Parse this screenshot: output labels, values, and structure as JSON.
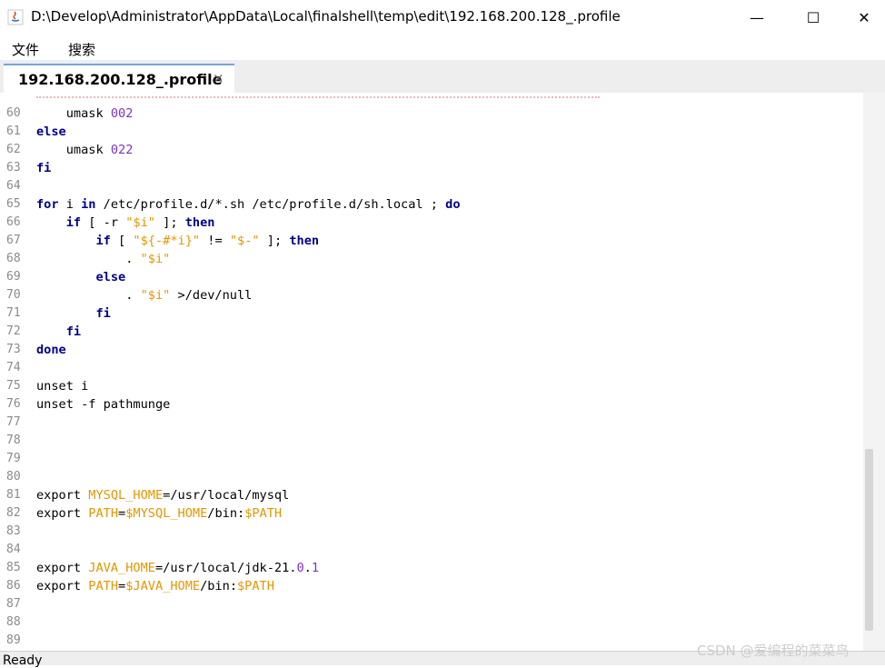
{
  "window": {
    "title": "D:\\Develop\\Administrator\\AppData\\Local\\finalshell\\temp\\edit\\192.168.200.128_.profile",
    "minimize": "—",
    "maximize": "☐",
    "close": "✕"
  },
  "menu": [
    "文件",
    "搜索"
  ],
  "tab": {
    "label": "192.168.200.128_.profile",
    "close": "×"
  },
  "editor": {
    "lines": [
      {
        "n": "60",
        "code": [
          {
            "t": "    umask "
          },
          {
            "t": "002",
            "c": "num"
          }
        ]
      },
      {
        "n": "61",
        "code": [
          {
            "t": "else",
            "c": "kw"
          }
        ]
      },
      {
        "n": "62",
        "code": [
          {
            "t": "    umask "
          },
          {
            "t": "022",
            "c": "num"
          }
        ]
      },
      {
        "n": "63",
        "code": [
          {
            "t": "fi",
            "c": "kw"
          }
        ]
      },
      {
        "n": "64",
        "code": []
      },
      {
        "n": "65",
        "code": [
          {
            "t": "for",
            "c": "kw"
          },
          {
            "t": " i "
          },
          {
            "t": "in",
            "c": "kw"
          },
          {
            "t": " /etc/profile.d/*.sh /etc/profile.d/sh.local ; "
          },
          {
            "t": "do",
            "c": "kw"
          }
        ]
      },
      {
        "n": "66",
        "code": [
          {
            "t": "    "
          },
          {
            "t": "if",
            "c": "kw"
          },
          {
            "t": " [ -r "
          },
          {
            "t": "\"$i\"",
            "c": "str"
          },
          {
            "t": " ]; "
          },
          {
            "t": "then",
            "c": "kw"
          }
        ]
      },
      {
        "n": "67",
        "code": [
          {
            "t": "        "
          },
          {
            "t": "if",
            "c": "kw"
          },
          {
            "t": " [ "
          },
          {
            "t": "\"${-#*i}\"",
            "c": "str"
          },
          {
            "t": " != "
          },
          {
            "t": "\"$-\"",
            "c": "str"
          },
          {
            "t": " ]; "
          },
          {
            "t": "then",
            "c": "kw"
          }
        ]
      },
      {
        "n": "68",
        "code": [
          {
            "t": "            . "
          },
          {
            "t": "\"$i\"",
            "c": "str"
          }
        ]
      },
      {
        "n": "69",
        "code": [
          {
            "t": "        "
          },
          {
            "t": "else",
            "c": "kw"
          }
        ]
      },
      {
        "n": "70",
        "code": [
          {
            "t": "            . "
          },
          {
            "t": "\"$i\"",
            "c": "str"
          },
          {
            "t": " >/dev/null"
          }
        ]
      },
      {
        "n": "71",
        "code": [
          {
            "t": "        "
          },
          {
            "t": "fi",
            "c": "kw"
          }
        ]
      },
      {
        "n": "72",
        "code": [
          {
            "t": "    "
          },
          {
            "t": "fi",
            "c": "kw"
          }
        ]
      },
      {
        "n": "73",
        "code": [
          {
            "t": "done",
            "c": "kw"
          }
        ]
      },
      {
        "n": "74",
        "code": []
      },
      {
        "n": "75",
        "code": [
          {
            "t": "unset i"
          }
        ]
      },
      {
        "n": "76",
        "code": [
          {
            "t": "unset -f pathmunge"
          }
        ]
      },
      {
        "n": "77",
        "code": []
      },
      {
        "n": "78",
        "code": []
      },
      {
        "n": "79",
        "code": []
      },
      {
        "n": "80",
        "code": []
      },
      {
        "n": "81",
        "code": [
          {
            "t": "export "
          },
          {
            "t": "MYSQL_HOME",
            "c": "var"
          },
          {
            "t": "=/usr/local/mysql"
          }
        ]
      },
      {
        "n": "82",
        "code": [
          {
            "t": "export "
          },
          {
            "t": "PATH",
            "c": "var"
          },
          {
            "t": "="
          },
          {
            "t": "$MYSQL_HOME",
            "c": "var"
          },
          {
            "t": "/bin:"
          },
          {
            "t": "$PATH",
            "c": "var"
          }
        ]
      },
      {
        "n": "83",
        "code": []
      },
      {
        "n": "84",
        "code": []
      },
      {
        "n": "85",
        "code": [
          {
            "t": "export "
          },
          {
            "t": "JAVA_HOME",
            "c": "var"
          },
          {
            "t": "=/usr/local/jdk-21."
          },
          {
            "t": "0",
            "c": "num"
          },
          {
            "t": "."
          },
          {
            "t": "1",
            "c": "num"
          }
        ]
      },
      {
        "n": "86",
        "code": [
          {
            "t": "export "
          },
          {
            "t": "PATH",
            "c": "var"
          },
          {
            "t": "="
          },
          {
            "t": "$JAVA_HOME",
            "c": "var"
          },
          {
            "t": "/bin:"
          },
          {
            "t": "$PATH",
            "c": "var"
          }
        ]
      },
      {
        "n": "87",
        "code": []
      },
      {
        "n": "88",
        "code": []
      },
      {
        "n": "89",
        "code": []
      }
    ]
  },
  "status": "Ready",
  "watermark": "CSDN @爱编程的菜菜鸟"
}
